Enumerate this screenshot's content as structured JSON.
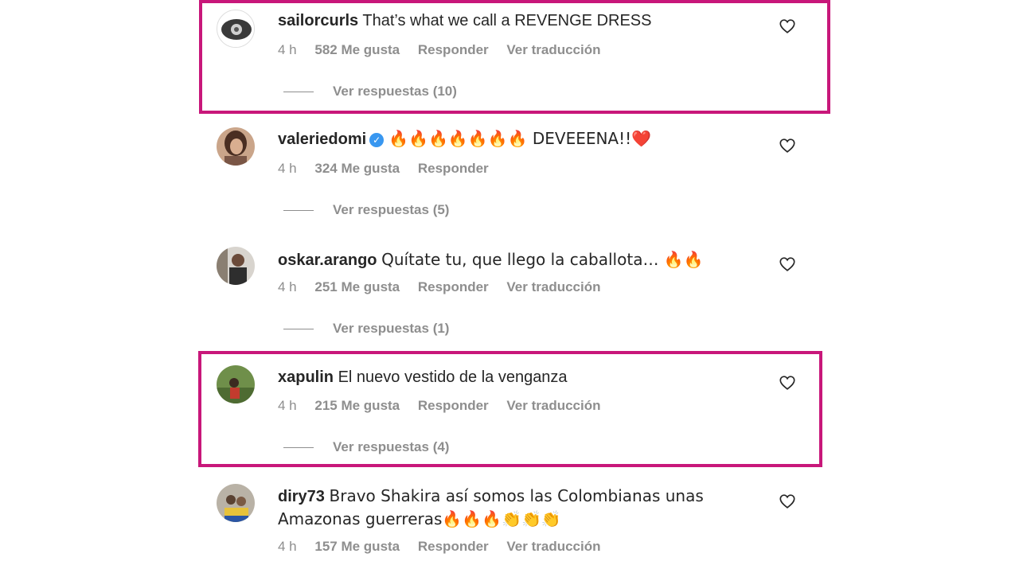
{
  "comments": [
    {
      "username": "sailorcurls",
      "text": "That’s what we call a REVENGE DRESS",
      "time": "4 h",
      "likes": "582 Me gusta",
      "reply": "Responder",
      "translate": "Ver traducción",
      "view_replies": "Ver respuestas (10)"
    },
    {
      "username": "valeriedomi",
      "verified": "✓",
      "text": "🔥🔥🔥🔥🔥🔥🔥 DEVEEENA!!❤️",
      "time": "4 h",
      "likes": "324 Me gusta",
      "reply": "Responder",
      "view_replies": "Ver respuestas (5)"
    },
    {
      "username": "oskar.arango",
      "text": "Quítate tu, que llego la caballota… 🔥🔥",
      "time": "4 h",
      "likes": "251 Me gusta",
      "reply": "Responder",
      "translate": "Ver traducción",
      "view_replies": "Ver respuestas (1)"
    },
    {
      "username": "xapulin",
      "text": "El nuevo vestido de la venganza",
      "time": "4 h",
      "likes": "215 Me gusta",
      "reply": "Responder",
      "translate": "Ver traducción",
      "view_replies": "Ver respuestas (4)"
    },
    {
      "username": "diry73",
      "text": "Bravo Shakira así somos las Colombianas unas Amazonas guerreras🔥🔥🔥👏👏👏",
      "time": "4 h",
      "likes": "157 Me gusta",
      "reply": "Responder",
      "translate": "Ver traducción"
    }
  ],
  "colors": {
    "highlight": "#c8177a",
    "meta_gray": "#8e8e8e",
    "verified_blue": "#3897f0"
  }
}
